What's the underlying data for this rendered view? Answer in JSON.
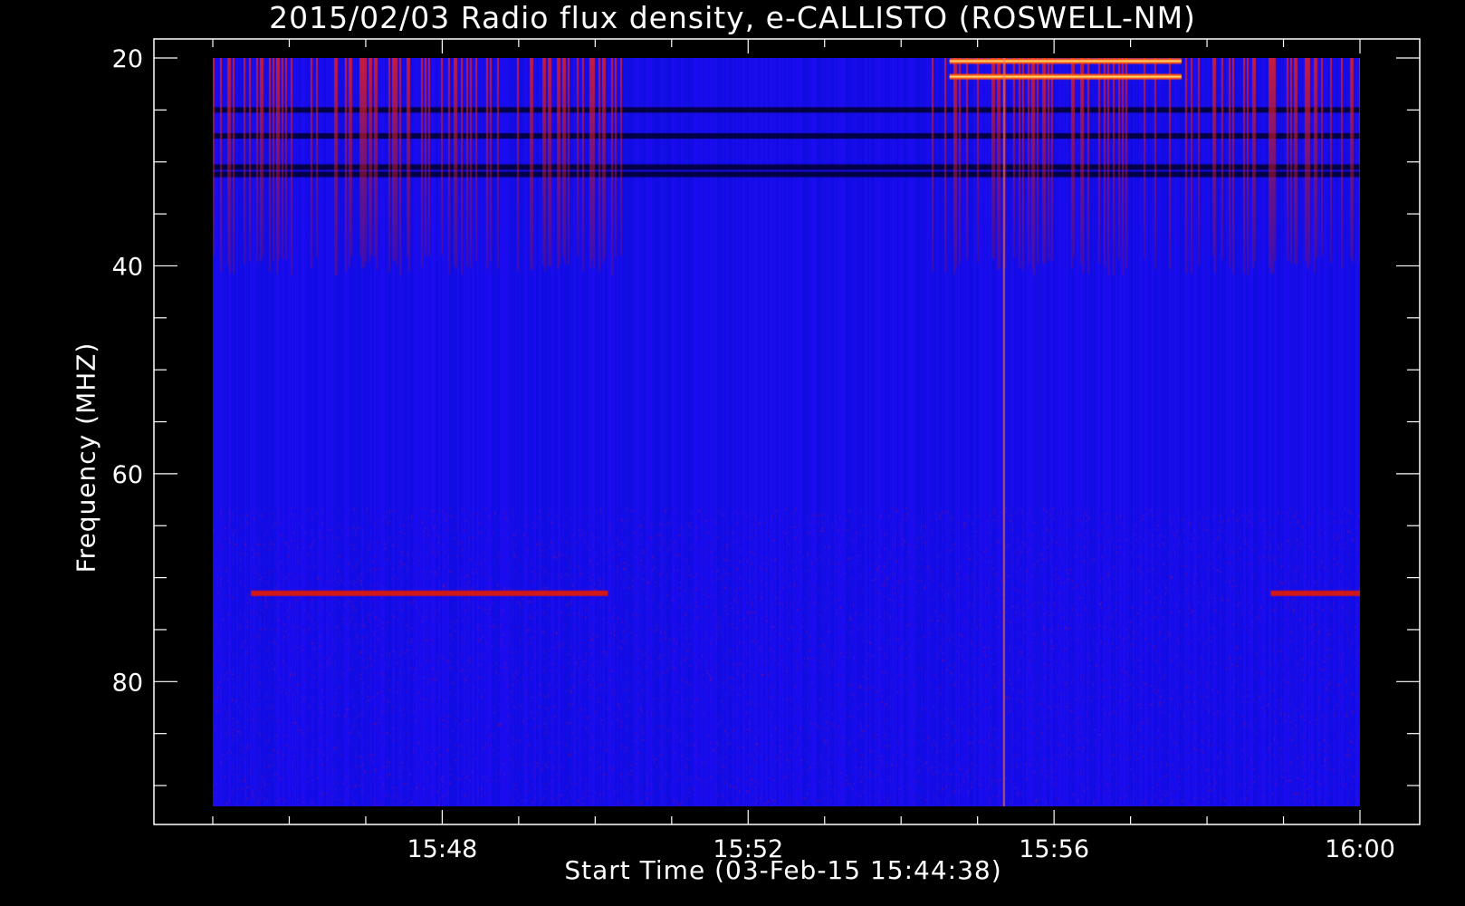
{
  "chart_data": {
    "type": "heatmap",
    "title": "2015/02/03  Radio flux density, e-CALLISTO (ROSWELL-NM)",
    "xlabel": "Start Time (03-Feb-15 15:44:38)",
    "ylabel": "Frequency (MHZ)",
    "x_range": [
      "15:45:00",
      "16:00:00"
    ],
    "y_range_mhz": [
      20,
      92
    ],
    "x_ticks": [
      "15:48",
      "15:52",
      "15:56",
      "16:00"
    ],
    "y_ticks": [
      20,
      40,
      60,
      80
    ],
    "y_axis_inverted": true,
    "colormap": [
      "#000000",
      "#1a1aff",
      "#0000ff",
      "#cc1010",
      "#ff4000",
      "#ffd000",
      "#ffffaa"
    ],
    "colors": {
      "background": "#000000",
      "axes": "#ffffff",
      "base_signal": "#1010f0"
    },
    "features": [
      {
        "name": "strong band",
        "freq_mhz": 20.3,
        "start": "15:54:38",
        "end": "15:57:40"
      },
      {
        "name": "strong band",
        "freq_mhz": 21.8,
        "start": "15:54:38",
        "end": "15:57:40"
      },
      {
        "name": "weak band",
        "freq_mhz": 71.5,
        "start": "15:45:30",
        "end": "15:50:10"
      },
      {
        "name": "weak band",
        "freq_mhz": 71.5,
        "start": "15:58:50",
        "end": "16:00:00"
      },
      {
        "name": "spike",
        "time": "15:55:20",
        "freq_mhz": [
          20,
          92
        ]
      }
    ]
  }
}
